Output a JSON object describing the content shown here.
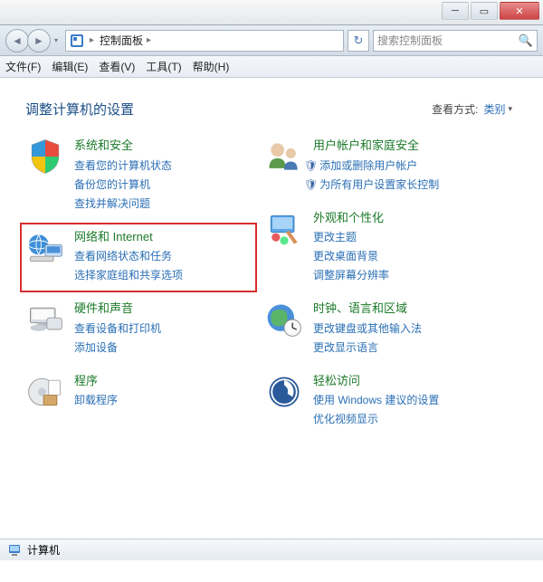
{
  "window": {
    "breadcrumb": [
      "控制面板"
    ],
    "search_placeholder": "搜索控制面板"
  },
  "menubar": [
    "文件(F)",
    "编辑(E)",
    "查看(V)",
    "工具(T)",
    "帮助(H)"
  ],
  "page": {
    "heading": "调整计算机的设置",
    "viewby_label": "查看方式:",
    "viewby_value": "类别"
  },
  "categories_left": [
    {
      "icon": "shield",
      "title": "系统和安全",
      "links": [
        "查看您的计算机状态",
        "备份您的计算机",
        "查找并解决问题"
      ],
      "bullets": []
    },
    {
      "icon": "network",
      "title": "网络和 Internet",
      "links": [
        "查看网络状态和任务",
        "选择家庭组和共享选项"
      ],
      "bullets": [],
      "highlight": true
    },
    {
      "icon": "hardware",
      "title": "硬件和声音",
      "links": [
        "查看设备和打印机",
        "添加设备"
      ],
      "bullets": []
    },
    {
      "icon": "programs",
      "title": "程序",
      "links": [
        "卸载程序"
      ],
      "bullets": []
    }
  ],
  "categories_right": [
    {
      "icon": "users",
      "title": "用户帐户和家庭安全",
      "links": [
        "添加或删除用户帐户",
        "为所有用户设置家长控制"
      ],
      "bullets": [
        0,
        1
      ]
    },
    {
      "icon": "appearance",
      "title": "外观和个性化",
      "links": [
        "更改主题",
        "更改桌面背景",
        "调整屏幕分辨率"
      ],
      "bullets": []
    },
    {
      "icon": "clock",
      "title": "时钟、语言和区域",
      "links": [
        "更改键盘或其他输入法",
        "更改显示语言"
      ],
      "bullets": []
    },
    {
      "icon": "ease",
      "title": "轻松访问",
      "links": [
        "使用 Windows 建议的设置",
        "优化视频显示"
      ],
      "bullets": []
    }
  ],
  "statusbar": {
    "label": "计算机"
  }
}
